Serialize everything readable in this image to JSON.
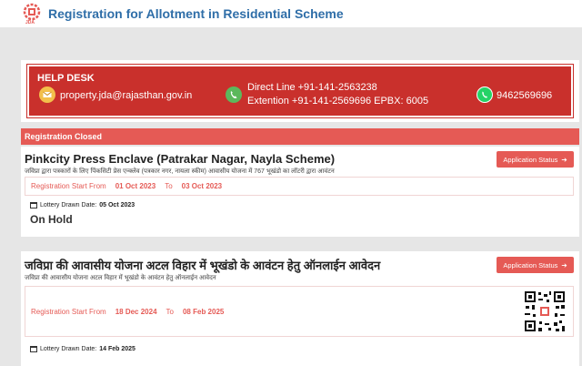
{
  "header": {
    "logo_text": "JDA",
    "title": "Registration for Allotment in Residential Scheme"
  },
  "helpdesk": {
    "title": "HELP DESK",
    "email": "property.jda@rajasthan.gov.in",
    "direct_line": "Direct Line +91-141-2563238",
    "extension": "Extention  +91-141-2569696 EPBX: 6005",
    "whatsapp": "9462569696",
    "colors": {
      "background": "#c9302c",
      "email_icon": "#f3c04b",
      "phone_icon": "#5cb85c",
      "whatsapp_icon": "#25d366"
    }
  },
  "section": {
    "label": "Registration Closed"
  },
  "schemes": [
    {
      "title": "Pinkcity Press Enclave (Patrakar Nagar, Nayla Scheme)",
      "subtitle": "जविप्रा द्वारा पत्रकारों के लिए पिंकसिटी प्रेस एन्क्लेव (पत्रकार नगर, नायला स्कीम) आवासीय योजना में 767 भूखंडो का लॉटरी द्वारा आवंटन",
      "status_button": "Application Status",
      "reg_from_label": "Registration Start From",
      "reg_from": "01 Oct 2023",
      "reg_to_label": "To",
      "reg_to": "03 Oct 2023",
      "lottery_label": "Lottery Drawn Date:",
      "lottery_date": "05 Oct 2023",
      "status": "On Hold"
    },
    {
      "title": "जविप्रा की आवासीय योजना अटल विहार में भूखंडो के आवंटन हेतु ऑनलाईन आवेदन",
      "subtitle": "जविप्रा की आवासीय योजना अटल विहार में भूखंडो के आवंटन हेतु ऑनलाईन आवेदन",
      "status_button": "Application Status",
      "reg_from_label": "Registration Start From",
      "reg_from": "18 Dec 2024",
      "reg_to_label": "To",
      "reg_to": "08 Feb 2025",
      "lottery_label": "Lottery Drawn Date:",
      "lottery_date": "14 Feb 2025",
      "qr_icon": "qr-code-icon"
    }
  ],
  "colors": {
    "accent": "#e55a55",
    "brand_blue": "#2f6ea8"
  }
}
